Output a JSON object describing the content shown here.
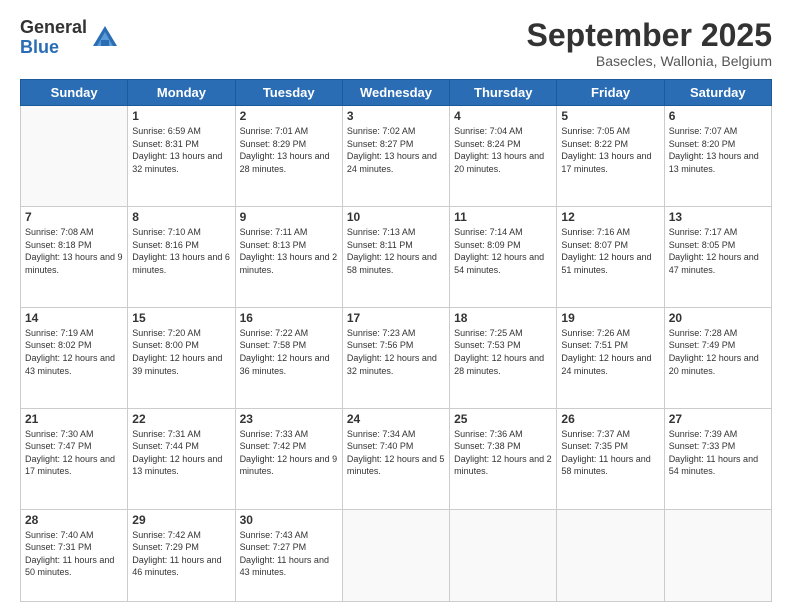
{
  "logo": {
    "general": "General",
    "blue": "Blue"
  },
  "header": {
    "month": "September 2025",
    "location": "Basecles, Wallonia, Belgium"
  },
  "weekdays": [
    "Sunday",
    "Monday",
    "Tuesday",
    "Wednesday",
    "Thursday",
    "Friday",
    "Saturday"
  ],
  "weeks": [
    [
      {
        "day": "",
        "info": ""
      },
      {
        "day": "1",
        "info": "Sunrise: 6:59 AM\nSunset: 8:31 PM\nDaylight: 13 hours and 32 minutes."
      },
      {
        "day": "2",
        "info": "Sunrise: 7:01 AM\nSunset: 8:29 PM\nDaylight: 13 hours and 28 minutes."
      },
      {
        "day": "3",
        "info": "Sunrise: 7:02 AM\nSunset: 8:27 PM\nDaylight: 13 hours and 24 minutes."
      },
      {
        "day": "4",
        "info": "Sunrise: 7:04 AM\nSunset: 8:24 PM\nDaylight: 13 hours and 20 minutes."
      },
      {
        "day": "5",
        "info": "Sunrise: 7:05 AM\nSunset: 8:22 PM\nDaylight: 13 hours and 17 minutes."
      },
      {
        "day": "6",
        "info": "Sunrise: 7:07 AM\nSunset: 8:20 PM\nDaylight: 13 hours and 13 minutes."
      }
    ],
    [
      {
        "day": "7",
        "info": "Sunrise: 7:08 AM\nSunset: 8:18 PM\nDaylight: 13 hours and 9 minutes."
      },
      {
        "day": "8",
        "info": "Sunrise: 7:10 AM\nSunset: 8:16 PM\nDaylight: 13 hours and 6 minutes."
      },
      {
        "day": "9",
        "info": "Sunrise: 7:11 AM\nSunset: 8:13 PM\nDaylight: 13 hours and 2 minutes."
      },
      {
        "day": "10",
        "info": "Sunrise: 7:13 AM\nSunset: 8:11 PM\nDaylight: 12 hours and 58 minutes."
      },
      {
        "day": "11",
        "info": "Sunrise: 7:14 AM\nSunset: 8:09 PM\nDaylight: 12 hours and 54 minutes."
      },
      {
        "day": "12",
        "info": "Sunrise: 7:16 AM\nSunset: 8:07 PM\nDaylight: 12 hours and 51 minutes."
      },
      {
        "day": "13",
        "info": "Sunrise: 7:17 AM\nSunset: 8:05 PM\nDaylight: 12 hours and 47 minutes."
      }
    ],
    [
      {
        "day": "14",
        "info": "Sunrise: 7:19 AM\nSunset: 8:02 PM\nDaylight: 12 hours and 43 minutes."
      },
      {
        "day": "15",
        "info": "Sunrise: 7:20 AM\nSunset: 8:00 PM\nDaylight: 12 hours and 39 minutes."
      },
      {
        "day": "16",
        "info": "Sunrise: 7:22 AM\nSunset: 7:58 PM\nDaylight: 12 hours and 36 minutes."
      },
      {
        "day": "17",
        "info": "Sunrise: 7:23 AM\nSunset: 7:56 PM\nDaylight: 12 hours and 32 minutes."
      },
      {
        "day": "18",
        "info": "Sunrise: 7:25 AM\nSunset: 7:53 PM\nDaylight: 12 hours and 28 minutes."
      },
      {
        "day": "19",
        "info": "Sunrise: 7:26 AM\nSunset: 7:51 PM\nDaylight: 12 hours and 24 minutes."
      },
      {
        "day": "20",
        "info": "Sunrise: 7:28 AM\nSunset: 7:49 PM\nDaylight: 12 hours and 20 minutes."
      }
    ],
    [
      {
        "day": "21",
        "info": "Sunrise: 7:30 AM\nSunset: 7:47 PM\nDaylight: 12 hours and 17 minutes."
      },
      {
        "day": "22",
        "info": "Sunrise: 7:31 AM\nSunset: 7:44 PM\nDaylight: 12 hours and 13 minutes."
      },
      {
        "day": "23",
        "info": "Sunrise: 7:33 AM\nSunset: 7:42 PM\nDaylight: 12 hours and 9 minutes."
      },
      {
        "day": "24",
        "info": "Sunrise: 7:34 AM\nSunset: 7:40 PM\nDaylight: 12 hours and 5 minutes."
      },
      {
        "day": "25",
        "info": "Sunrise: 7:36 AM\nSunset: 7:38 PM\nDaylight: 12 hours and 2 minutes."
      },
      {
        "day": "26",
        "info": "Sunrise: 7:37 AM\nSunset: 7:35 PM\nDaylight: 11 hours and 58 minutes."
      },
      {
        "day": "27",
        "info": "Sunrise: 7:39 AM\nSunset: 7:33 PM\nDaylight: 11 hours and 54 minutes."
      }
    ],
    [
      {
        "day": "28",
        "info": "Sunrise: 7:40 AM\nSunset: 7:31 PM\nDaylight: 11 hours and 50 minutes."
      },
      {
        "day": "29",
        "info": "Sunrise: 7:42 AM\nSunset: 7:29 PM\nDaylight: 11 hours and 46 minutes."
      },
      {
        "day": "30",
        "info": "Sunrise: 7:43 AM\nSunset: 7:27 PM\nDaylight: 11 hours and 43 minutes."
      },
      {
        "day": "",
        "info": ""
      },
      {
        "day": "",
        "info": ""
      },
      {
        "day": "",
        "info": ""
      },
      {
        "day": "",
        "info": ""
      }
    ]
  ]
}
